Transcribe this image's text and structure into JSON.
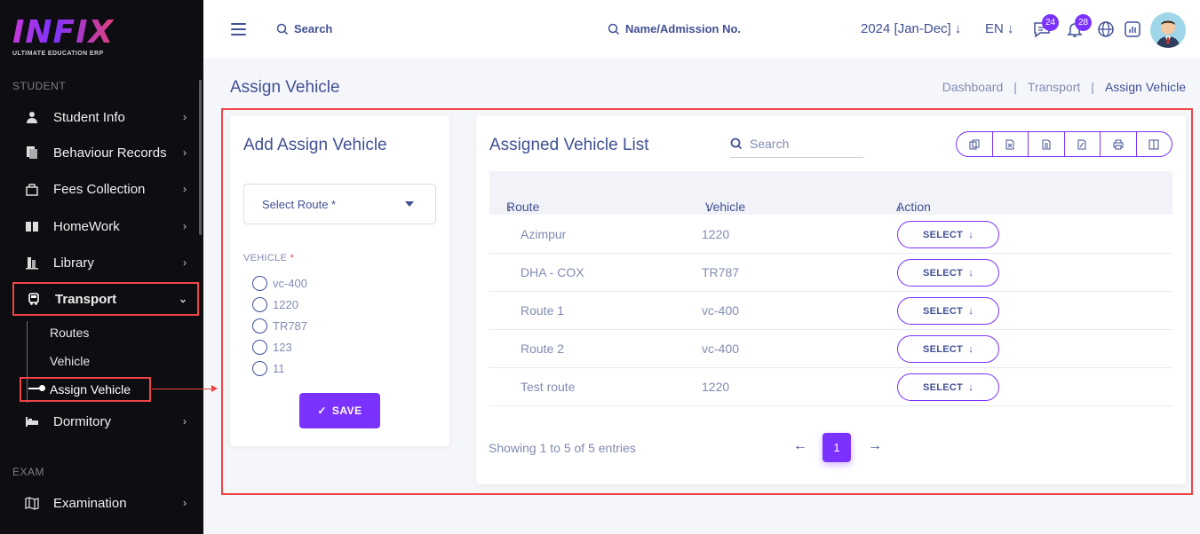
{
  "sidebar": {
    "logo": {
      "main": "INFIX",
      "sub": "ULTIMATE EDUCATION ERP"
    },
    "sections": {
      "student": "STUDENT",
      "exam": "EXAM"
    },
    "items": [
      {
        "label": "Student Info",
        "icon": "user-icon"
      },
      {
        "label": "Behaviour Records",
        "icon": "records-icon"
      },
      {
        "label": "Fees Collection",
        "icon": "fees-icon"
      },
      {
        "label": "HomeWork",
        "icon": "book-icon"
      },
      {
        "label": "Library",
        "icon": "library-icon"
      },
      {
        "label": "Transport",
        "icon": "bus-icon"
      },
      {
        "label": "Dormitory",
        "icon": "bed-icon"
      },
      {
        "label": "Examination",
        "icon": "map-icon"
      }
    ],
    "transport_sub": [
      "Routes",
      "Vehicle",
      "Assign Vehicle"
    ]
  },
  "topbar": {
    "search_label": "Search",
    "student_search_label": "Name/Admission No.",
    "year": "2024 [Jan-Dec]",
    "lang": "EN",
    "messages_count": "24",
    "notifications_count": "28"
  },
  "page": {
    "title": "Assign Vehicle",
    "breadcrumb": [
      "Dashboard",
      "|",
      "Transport",
      "|",
      "Assign Vehicle"
    ]
  },
  "form": {
    "title": "Add Assign Vehicle",
    "route_placeholder": "Select Route *",
    "vehicle_label": "VEHICLE",
    "required_mark": "*",
    "vehicles": [
      "vc-400",
      "1220",
      "TR787",
      "123",
      "11"
    ],
    "save_label": "SAVE"
  },
  "list": {
    "title": "Assigned Vehicle List",
    "search_placeholder": "Search",
    "columns": [
      "Route",
      "Vehicle",
      "Action"
    ],
    "rows": [
      {
        "route": "Azimpur",
        "vehicle": "1220",
        "action": "SELECT"
      },
      {
        "route": "DHA - COX",
        "vehicle": "TR787",
        "action": "SELECT"
      },
      {
        "route": "Route 1",
        "vehicle": "vc-400",
        "action": "SELECT"
      },
      {
        "route": "Route 2",
        "vehicle": "vc-400",
        "action": "SELECT"
      },
      {
        "route": "Test route",
        "vehicle": "1220",
        "action": "SELECT"
      }
    ],
    "showing": "Showing 1 to 5 of 5 entries",
    "page": "1"
  },
  "colors": {
    "accent": "#7c32ff",
    "text": "#415094",
    "highlight": "#ef4444"
  }
}
